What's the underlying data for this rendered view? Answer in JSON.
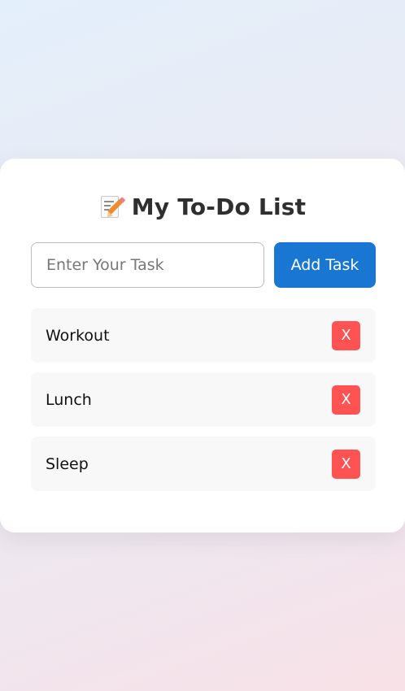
{
  "header": {
    "icon": "memo-icon",
    "title": "My To-Do List"
  },
  "form": {
    "placeholder": "Enter Your Task",
    "value": "",
    "add_label": "Add Task"
  },
  "tasks": [
    {
      "label": "Workout",
      "delete_label": "X"
    },
    {
      "label": "Lunch",
      "delete_label": "X"
    },
    {
      "label": "Sleep",
      "delete_label": "X"
    }
  ],
  "colors": {
    "accent": "#1976d2",
    "delete": "#ff5252",
    "card": "#ffffff",
    "item_background": "#f8f8f8"
  }
}
